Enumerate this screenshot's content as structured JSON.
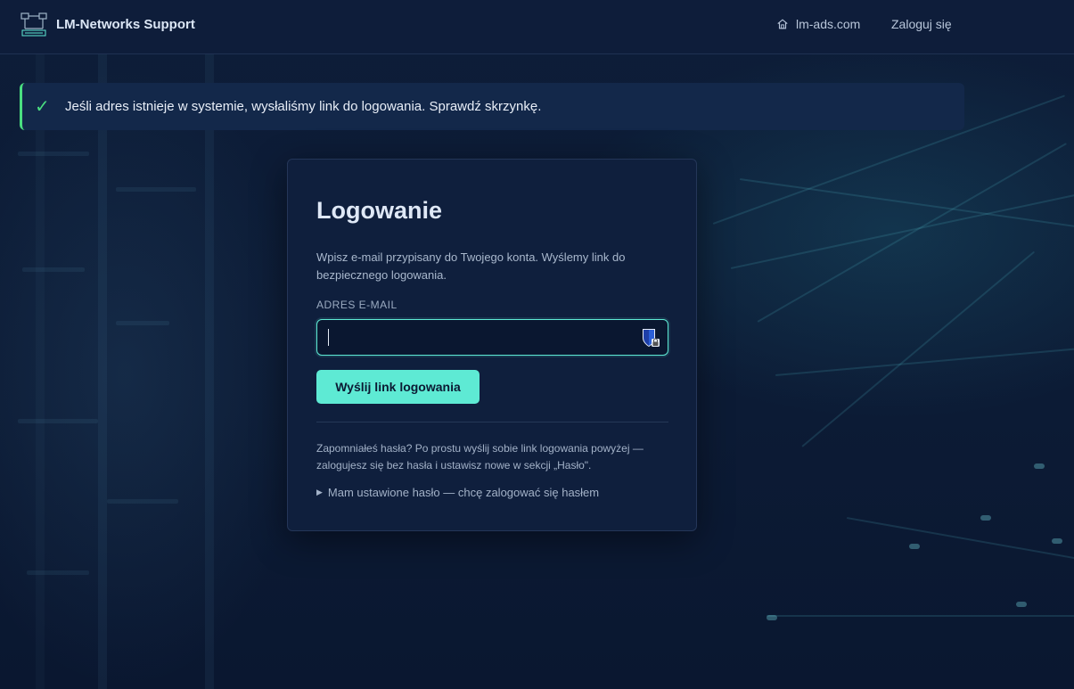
{
  "header": {
    "brand": "LM-Networks Support",
    "nav": [
      {
        "label": "lm-ads.com",
        "icon": "home-icon"
      },
      {
        "label": "Zaloguj się"
      }
    ]
  },
  "alert": {
    "icon": "check-icon",
    "text": "Jeśli adres istnieje w systemie, wysłaliśmy link do logowania. Sprawdź skrzynkę.",
    "color": "#4ade80"
  },
  "login": {
    "title": "Logowanie",
    "description": "Wpisz e-mail przypisany do Twojego konta. Wyślemy link do bezpiecznego logowania.",
    "email_label": "ADRES E-MAIL",
    "email_value": "",
    "submit_label": "Wyślij link logowania",
    "help_text": "Zapomniałeś hasła? Po prostu wyślij sobie link logowania powyżej — zalogujesz się bez hasła i ustawisz nowe w sekcji „Hasło\".",
    "password_toggle": "Mam ustawione hasło — chcę zalogować się hasłem"
  },
  "colors": {
    "accent": "#5eead4",
    "success": "#4ade80",
    "card": "#0f1f3d",
    "background": "#0b1a33"
  }
}
